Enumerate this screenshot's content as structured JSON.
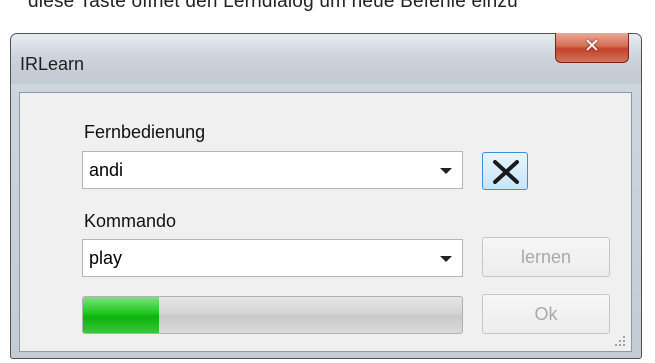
{
  "background_text": "diese Taste öffnet den Lerndialog um neue Befehle einzu",
  "window": {
    "title": "IRLearn",
    "close_glyph": "✕"
  },
  "form": {
    "remote_label": "Fernbedienung",
    "remote_value": "andi",
    "command_label": "Kommando",
    "command_value": "play",
    "learn_button": "lernen",
    "ok_button": "Ok",
    "delete_icon": "x-icon"
  },
  "progress": {
    "fraction": 0.2,
    "color": "#1ec81e"
  }
}
